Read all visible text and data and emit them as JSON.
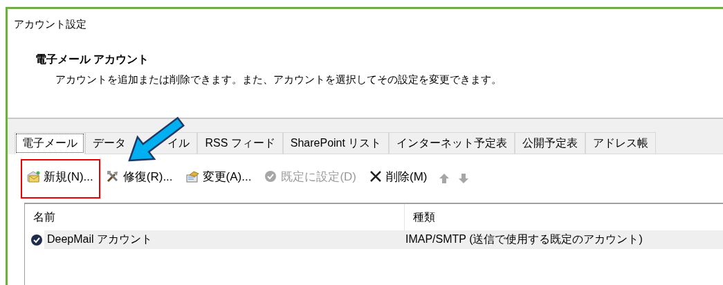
{
  "window": {
    "title": "アカウント設定"
  },
  "header": {
    "heading": "電子メール アカウント",
    "description": "アカウントを追加または削除できます。また、アカウントを選択してその設定を変更できます。"
  },
  "tabs": [
    {
      "label": "電子メール",
      "selected": true
    },
    {
      "label": "データ イル",
      "selected": false,
      "covered": true
    },
    {
      "label": "RSS フィード",
      "selected": false
    },
    {
      "label": "SharePoint リスト",
      "selected": false
    },
    {
      "label": "インターネット予定表",
      "selected": false
    },
    {
      "label": "公開予定表",
      "selected": false
    },
    {
      "label": "アドレス帳",
      "selected": false
    }
  ],
  "toolbar": [
    {
      "kind": "new",
      "label": "新規(N)...",
      "disabled": false,
      "highlighted": true
    },
    {
      "kind": "repair",
      "label": "修復(R)...",
      "disabled": false,
      "highlighted": false
    },
    {
      "kind": "change",
      "label": "変更(A)...",
      "disabled": false,
      "highlighted": false
    },
    {
      "kind": "default",
      "label": "既定に設定(D)",
      "disabled": true,
      "highlighted": false
    },
    {
      "kind": "delete",
      "label": "削除(M)",
      "disabled": false,
      "highlighted": false
    },
    {
      "kind": "up",
      "disabled": true,
      "highlighted": false
    },
    {
      "kind": "down",
      "disabled": true,
      "highlighted": false
    }
  ],
  "table": {
    "columns": [
      "名前",
      "種類"
    ],
    "rows": [
      {
        "selected": true,
        "default": true,
        "cells": [
          "DeepMail アカウント",
          "IMAP/SMTP (送信で使用する既定のアカウント)"
        ]
      }
    ]
  },
  "pointer_arrow": true
}
